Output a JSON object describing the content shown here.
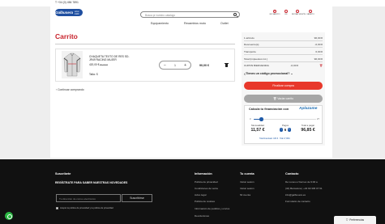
{
  "topbar": {
    "phone": "T +34 (0) 456 7891"
  },
  "header": {
    "logo": {
      "name": "Galbusera",
      "since": "since 1929"
    },
    "search_placeholder": "Busca pr nuestro catalogo",
    "icons": [
      {
        "name": "heart-icon",
        "label": "MI CARRITO"
      },
      {
        "name": "flag-icon",
        "label": "ES"
      },
      {
        "name": "user-icon",
        "label": "INICIAR SESIÓN"
      },
      {
        "name": "cart-icon",
        "label": "CARRITO"
      }
    ],
    "nav": [
      "Equipamiento",
      "Recambios moto",
      "Outlet"
    ]
  },
  "cart": {
    "title": "Carrito",
    "item": {
      "name": "CHAQUETA TEXTO DE RES SD-JR49 RACING MUJER",
      "price": "420,00 €",
      "old_price": "90,00 €",
      "size": "Talla: S",
      "quantity": "1",
      "total": "90,00 €"
    },
    "continue_label": "Continuar comprando"
  },
  "summary": {
    "rows": [
      {
        "label": "1 artículo",
        "value": "90,00 €"
      },
      {
        "label": "Descuento(s)",
        "value": "-0,00 €"
      },
      {
        "label": "Transporte",
        "value": "0,00 €"
      },
      {
        "label": "Total (impuestos inc.)",
        "value": "90,00 €"
      },
      {
        "label": "CUPON BIENVENIDA",
        "value": "-0,00 €"
      }
    ],
    "coupon_label": "¿Tienes un código promocional?",
    "checkout_label": "Finalizar compra",
    "empty_cart_label": "Vaciar carrito"
  },
  "financing": {
    "title": "Calcula tu financiación con",
    "provider": "Aplazame",
    "slider": {
      "min_label": "3",
      "max_label": "27",
      "value": 6,
      "min": 3,
      "max": 27
    },
    "monthly_label": "Mensualidad",
    "monthly_value": "11,57 €",
    "payments_label": "Pagos",
    "payments_value": "6",
    "total_label": "Total a pagar",
    "total_value": "96,85 €",
    "footnote": "Total financiado: 180 € · TAE 17,99%"
  },
  "footer": {
    "subscribe": {
      "heading": "Suscríbete",
      "title": "REGÍSTRATE PARA SABER NUESTRAS NOVEDADES",
      "placeholder": "Tu dirección de correo electrónico",
      "button": "Suscribirse",
      "consent": "Acepto la política de privacidad y la política de privacidad"
    },
    "columns": [
      {
        "heading": "Información",
        "links": [
          "Política de privacidad",
          "Condiciones de venta",
          "Aviso legal",
          "Política de cookies",
          "Información de pedidos y envíos",
          "Devoluciones"
        ]
      },
      {
        "heading": "Tu cuenta",
        "links": [
          "Iniciar sesión",
          "Iniciar sesión",
          "Mi cuenta"
        ]
      },
      {
        "heading": "Contacto",
        "links": [
          "De Lunes a Viernes de 9:00 a",
          "(34) Barcelona | +34 93 345 07 61",
          "info@galbusera.es",
          "Formulario de contacto"
        ]
      }
    ]
  },
  "cookie_prefs": "Preferencias"
}
